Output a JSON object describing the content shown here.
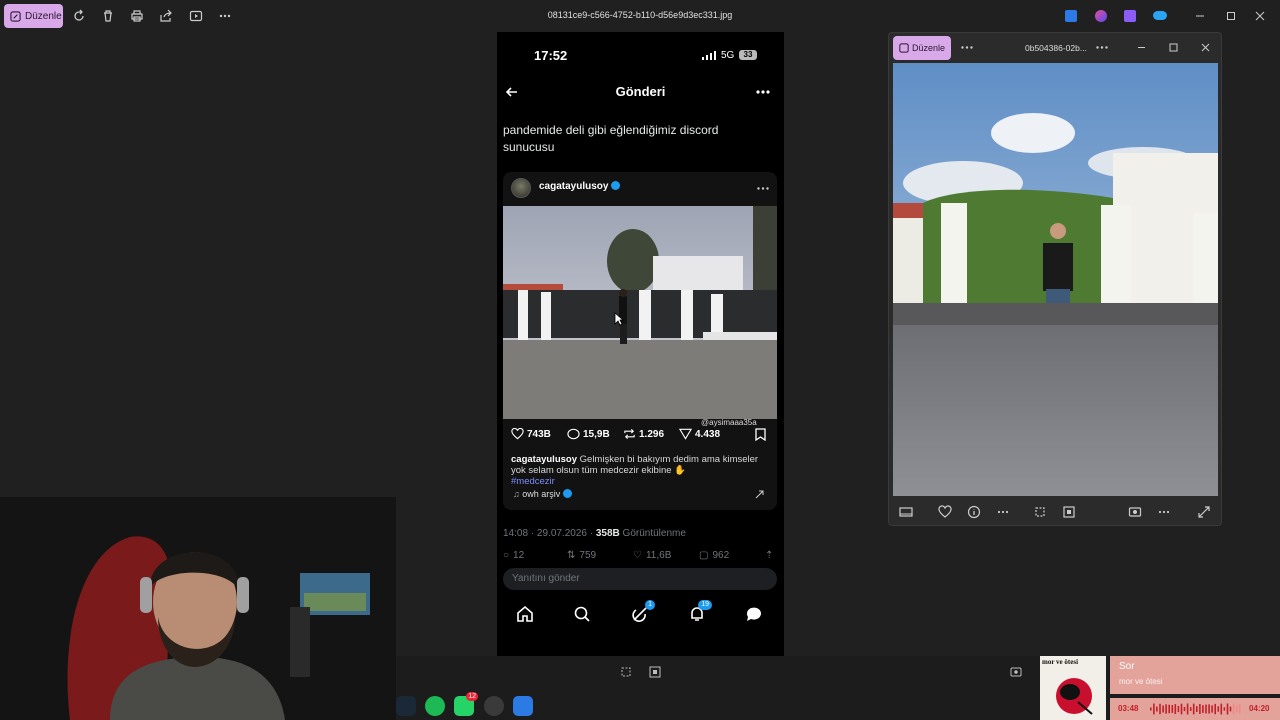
{
  "toolbar": {
    "edit_label": "Düzenle",
    "filename": "08131ce9-c566-4752-b110-d56e9d3ec331.jpg",
    "icons": [
      "rotate-icon",
      "delete-icon",
      "print-icon",
      "share-icon",
      "slideshow-icon",
      "more-icon"
    ]
  },
  "phone": {
    "time": "17:52",
    "network": "5G",
    "battery": "33",
    "header_title": "Gönderi",
    "post_text": "pandemide deli gibi eğlendiğimiz discord sunucusu",
    "embed": {
      "username": "cagatayulusoy",
      "watermark": "@aysimaaa35a",
      "likes": "743B",
      "comments": "15,9B",
      "reposts": "1.296",
      "shares": "4.438",
      "caption_user": "cagatayulusoy",
      "caption_text": "Gelmişken bi bakıyım dedim ama kimseler yok  selam olsun  tüm medcezir ekibine ✋",
      "hashtag": "#medcezir",
      "sound": "owh arşiv"
    },
    "meta_time": "14:08 · 29.07.2026 · ",
    "meta_views_num": "358B",
    "meta_views_label": " Görüntülenme",
    "actions": {
      "replies": "12",
      "reposts": "759",
      "likes": "11,6B",
      "bookmarks": "962"
    },
    "reply_placeholder": "Yanıtını gönder",
    "nav_badges": {
      "grok": "1",
      "notifications": "19"
    }
  },
  "viewer": {
    "edit_label": "Düzenle",
    "filename": "0b504386-02b..."
  },
  "taskbar": {
    "whatsapp_badge": "12"
  },
  "music": {
    "album_text": "mor ve ötesi",
    "title": "Sor",
    "artist": "mor ve ötesi",
    "elapsed": "03:48",
    "total": "04:20",
    "progress": 0.88
  }
}
